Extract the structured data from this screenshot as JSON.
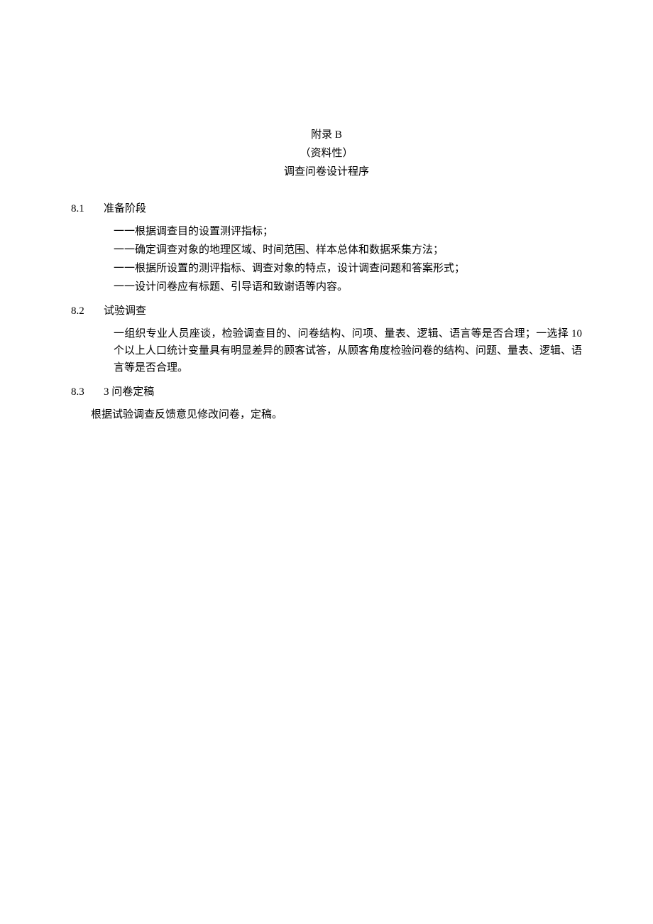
{
  "header": {
    "line1": "附录 B",
    "line2": "（资料性）",
    "line3": "调查问卷设计程序"
  },
  "sections": [
    {
      "num": "8.1",
      "title": "准备阶段",
      "indentClass": "body-indent",
      "paras": [
        "一一根据调查目的设置测评指标；",
        "一一确定调查对象的地理区域、时间范围、样本总体和数据釆集方法；",
        "一一根据所设置的测评指标、调查对象的特点，设计调查问题和答案形式；",
        "一一设计问卷应有标题、引导语和致谢语等内容。"
      ]
    },
    {
      "num": "8.2",
      "title": "试验调查",
      "indentClass": "body-indent",
      "paras": [
        "一组织专业人员座谈，检验调查目的、问卷结构、问项、量表、逻辑、语言等是否合理；一选择 10 个以上人口统计变量具有明显差异的顾客试答，从顾客角度检验问卷的结构、问题、量表、逻辑、语言等是否合理。"
      ]
    },
    {
      "num": "8.3",
      "title": "3 问卷定稿",
      "indentClass": "body-indent-less",
      "paras": [
        "根据试验调查反馈意见修改问卷，定稿。"
      ]
    }
  ]
}
